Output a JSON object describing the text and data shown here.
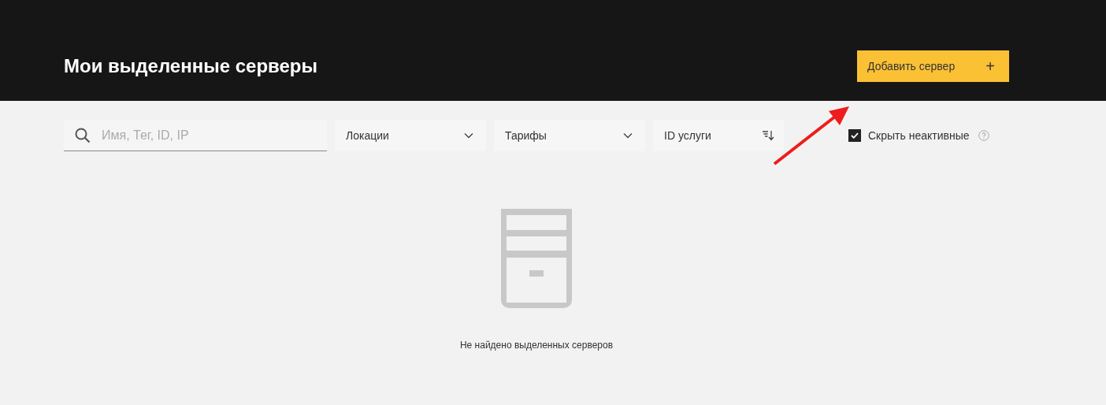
{
  "header": {
    "title": "Мои выделенные серверы",
    "add_button": {
      "label": "Добавить сервер",
      "icon": "+"
    }
  },
  "filters": [
    {
      "kind": "search",
      "placeholder": "Имя, Тег, ID, IP"
    },
    {
      "kind": "dropdown",
      "label": "Локации"
    },
    {
      "kind": "dropdown",
      "label": "Тарифы"
    },
    {
      "kind": "sort",
      "label": "ID услуги"
    }
  ],
  "hide_inactive": {
    "label": "Скрыть неактивные",
    "checked": true
  },
  "empty_state": {
    "message": "Не найдено выделенных серверов"
  }
}
